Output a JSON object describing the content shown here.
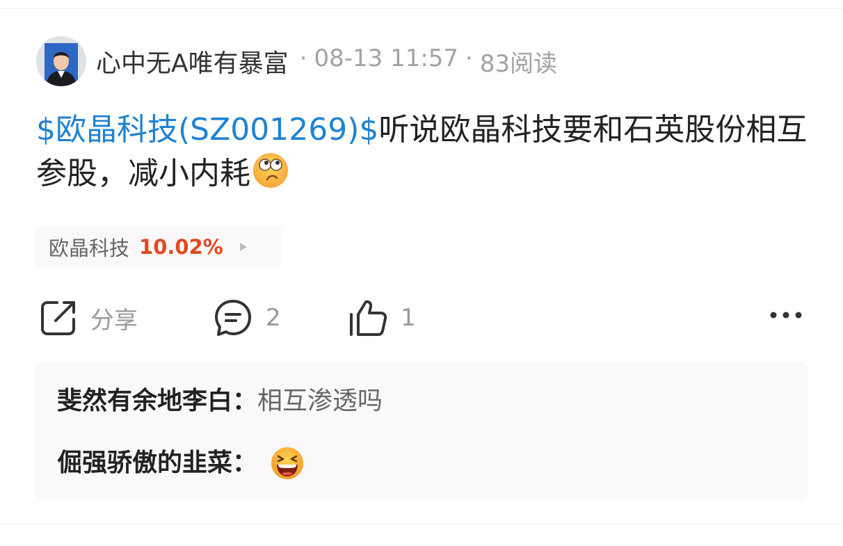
{
  "post": {
    "author": "心中无A唯有暴富",
    "separator": "·",
    "date": "08-13 11:57",
    "views": "83阅读",
    "stock_tag": "$欧晶科技(SZ001269)$",
    "body_text": "听说欧晶科技要和石英股份相互参股，减小内耗",
    "emoji": "doubtful-face-icon"
  },
  "stock_chip": {
    "name": "欧晶科技",
    "change": "10.02%",
    "change_color": "#e2491f"
  },
  "actions": {
    "share_label": "分享",
    "comment_count": "2",
    "like_count": "1"
  },
  "comments": [
    {
      "user": "斐然有余地李白：",
      "text": "相互渗透吗"
    },
    {
      "user": "倔强骄傲的韭菜：",
      "text": "",
      "emoji": "grinning-squint-face-icon"
    }
  ],
  "colors": {
    "link": "#1e82d2",
    "muted": "#a2a2a2",
    "panel": "#fbf8fb"
  }
}
